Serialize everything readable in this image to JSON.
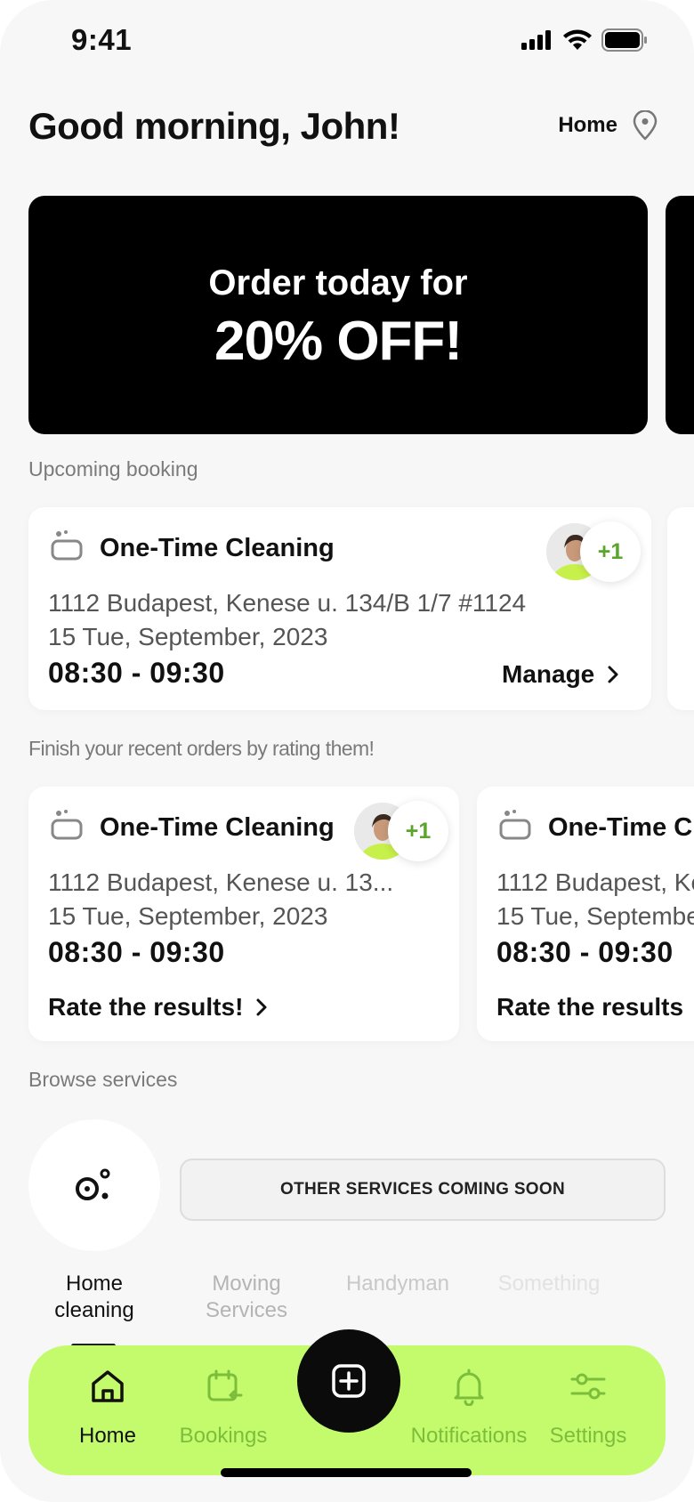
{
  "status_bar": {
    "time": "9:41"
  },
  "header": {
    "greeting": "Good morning, John!",
    "location_label": "Home"
  },
  "promo": {
    "line1": "Order today for",
    "line2": "20% OFF!"
  },
  "upcoming": {
    "section_title": "Upcoming booking",
    "card": {
      "title": "One-Time Cleaning",
      "address": "1112 Budapest, Kenese u. 134/B 1/7 #1124",
      "date": "15 Tue, September, 2023",
      "time": "08:30 - 09:30",
      "action": "Manage",
      "extra_staff": "+1"
    }
  },
  "recent": {
    "section_title": "Finish your recent orders by rating them!",
    "cards": [
      {
        "title": "One-Time Cleaning",
        "address": "1112 Budapest, Kenese u. 13...",
        "date": "15 Tue, September, 2023",
        "time": "08:30 - 09:30",
        "action": "Rate the  results!",
        "extra_staff": "+1"
      },
      {
        "title": "One-Time Cl",
        "address": "1112 Budapest, Ke",
        "date": "15 Tue, Septembe",
        "time": "08:30 - 09:30",
        "action": "Rate the  results"
      }
    ]
  },
  "browse": {
    "section_title": "Browse services",
    "services": [
      {
        "label_line1": "Home",
        "label_line2": "cleaning"
      },
      {
        "label_line1": "Moving",
        "label_line2": "Services"
      },
      {
        "label_line1": "Handyman",
        "label_line2": ""
      },
      {
        "label_line1": "Something",
        "label_line2": ""
      }
    ],
    "coming_soon": "OTHER SERVICES COMING SOON"
  },
  "nav": {
    "items": [
      {
        "label": "Home",
        "icon": "house-icon",
        "active": true
      },
      {
        "label": "Bookings",
        "icon": "calendar-icon",
        "active": false
      },
      {
        "label": "Notifications",
        "icon": "bell-icon",
        "active": false
      },
      {
        "label": "Settings",
        "icon": "sliders-icon",
        "active": false
      }
    ],
    "fab_icon": "plus-square-icon"
  },
  "colors": {
    "accent": "#c4fb6d",
    "badge_text": "#5aa52a",
    "inactive_nav": "#7dbd3c",
    "promo_bg": "#000000"
  }
}
